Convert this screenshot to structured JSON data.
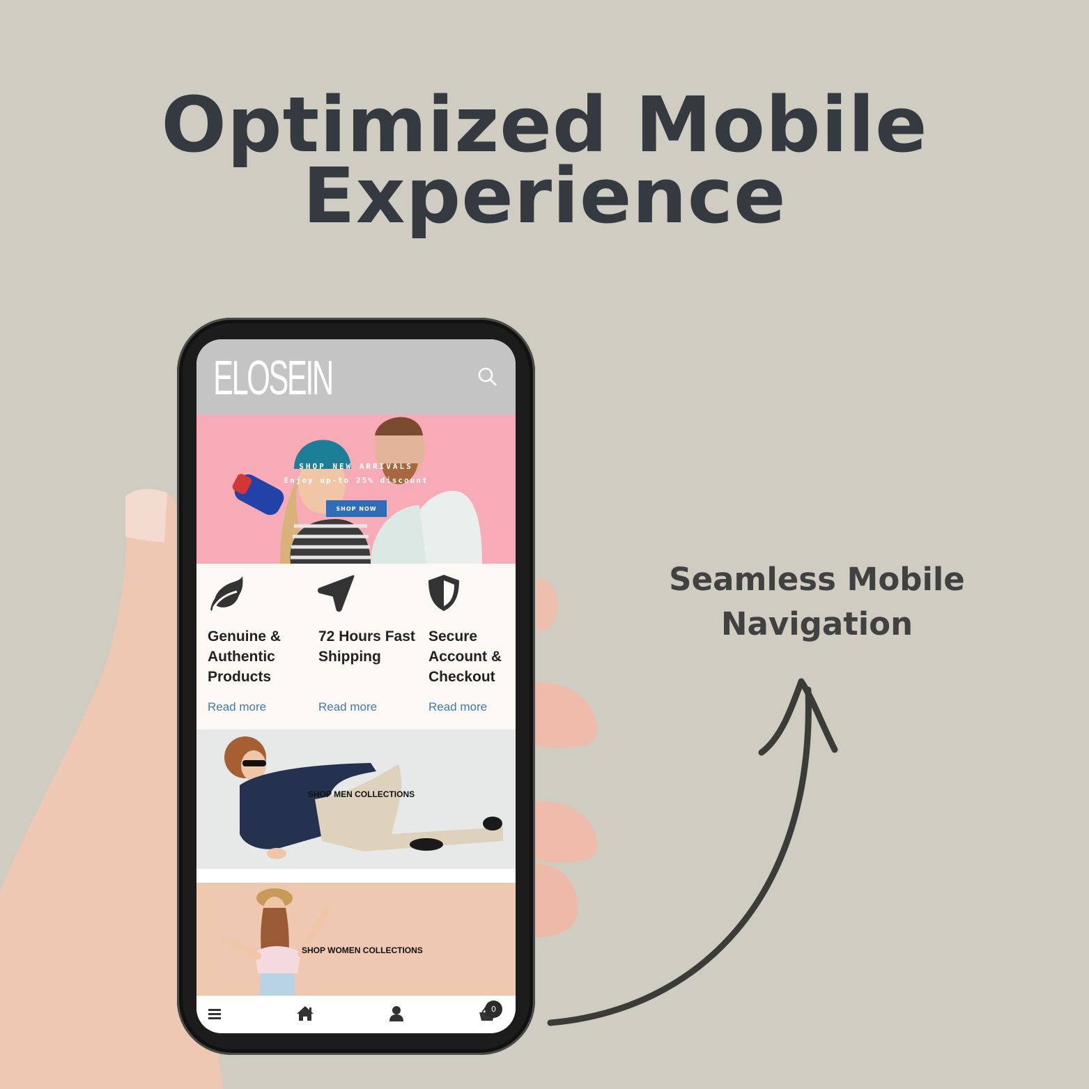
{
  "headline": {
    "line1": "Optimized Mobile",
    "line2": "Experience"
  },
  "side_caption": {
    "line1": "Seamless Mobile",
    "line2": "Navigation"
  },
  "colors": {
    "background": "#cfccc1",
    "headline": "#343a40",
    "topbar": "#c4c4c4",
    "hero_bg": "#f6abb6",
    "accent_button": "#2f6db8",
    "link": "#3f78b5",
    "women_bg": "#eec8b1"
  },
  "phone": {
    "brand": "ELOSEIN",
    "search_icon": "search-icon",
    "hero": {
      "title": "SHOP NEW ARRIVALS",
      "subtitle": "Enjoy up-to 25% discount",
      "button_label": "SHOP NOW"
    },
    "features": [
      {
        "icon": "leaf-icon",
        "title": "Genuine & Authentic Products",
        "link": "Read more"
      },
      {
        "icon": "navigation-arrow-icon",
        "title": "72 Hours Fast Shipping",
        "link": "Read more"
      },
      {
        "icon": "shield-icon",
        "title": "Secure Account & Checkout",
        "link": "Read more"
      }
    ],
    "collections": {
      "men": "SHOP MEN COLLECTIONS",
      "women": "SHOP WOMEN COLLECTIONS"
    },
    "bottom_nav": {
      "items": [
        "menu-icon",
        "home-icon",
        "user-icon",
        "cart-icon"
      ],
      "cart_count": "0"
    }
  }
}
